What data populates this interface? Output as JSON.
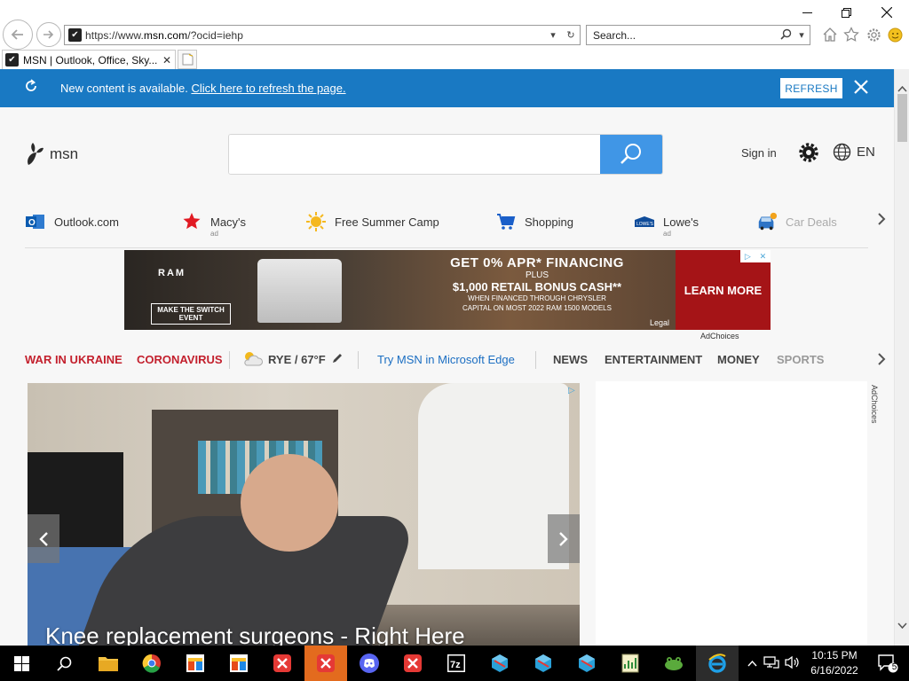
{
  "browser": {
    "url_prefix": "https://www.",
    "url_host": "msn.com",
    "url_rest": "/?ocid=iehp",
    "search_placeholder": "Search...",
    "tab_title": "MSN | Outlook, Office, Sky..."
  },
  "banner": {
    "message": "New content is available.",
    "link": "Click here to refresh the page.",
    "button": "REFRESH"
  },
  "header": {
    "logo_text": "msn",
    "sign_in": "Sign in",
    "language": "EN"
  },
  "quick_links": [
    {
      "label": "Outlook.com",
      "ad": ""
    },
    {
      "label": "Macy's",
      "ad": "ad"
    },
    {
      "label": "Free Summer Camp",
      "ad": ""
    },
    {
      "label": "Shopping",
      "ad": ""
    },
    {
      "label": "Lowe's",
      "ad": "ad"
    },
    {
      "label": "Car Deals",
      "ad": ""
    }
  ],
  "ad_banner": {
    "brand": "RAM",
    "switch": "MAKE THE SWITCH EVENT",
    "line1": "GET 0% APR* FINANCING",
    "line2": "PLUS",
    "line3": "$1,000 RETAIL BONUS CASH**",
    "line4": "WHEN FINANCED THROUGH CHRYSLER",
    "line5": "CAPITAL ON MOST 2022 RAM 1500 MODELS",
    "cta": "LEARN MORE",
    "legal": "Legal",
    "adchoices": "AdChoices"
  },
  "nav": {
    "war": "WAR IN UKRAINE",
    "covid": "CORONAVIRUS",
    "weather": "RYE / 67°F",
    "edge": "Try MSN in Microsoft Edge",
    "news": "NEWS",
    "entertainment": "ENTERTAINMENT",
    "money": "MONEY",
    "sports": "SPORTS"
  },
  "hero": {
    "caption": "Knee replacement surgeons - Right Here"
  },
  "side_ad": {
    "adchoices": "AdChoices"
  },
  "taskbar": {
    "time": "10:15 PM",
    "date": "6/16/2022",
    "notifications": "5"
  },
  "colors": {
    "banner": "#1979c3",
    "search_button": "#4096e6",
    "nav_red": "#c3202d",
    "link_blue": "#1b6ec2"
  }
}
